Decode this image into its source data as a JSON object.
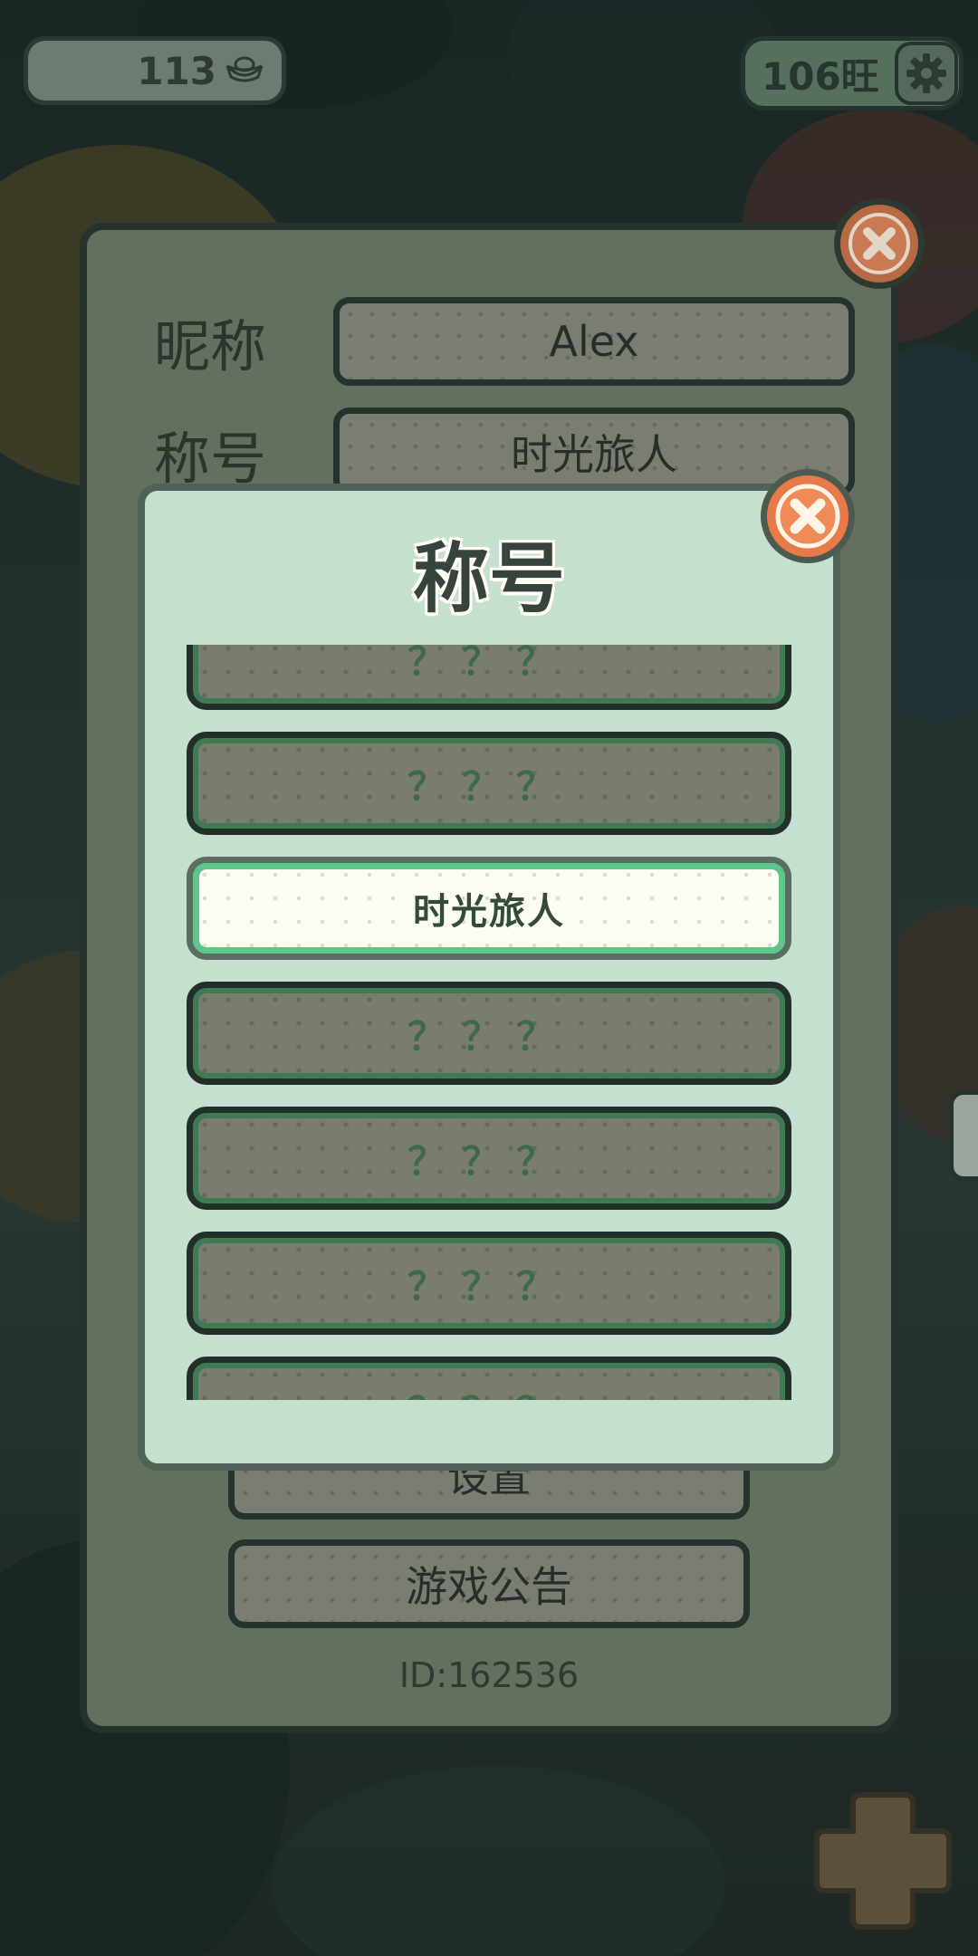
{
  "hud": {
    "currency_value": "113",
    "currency_icon": "ingot-icon",
    "wang_value": "106旺",
    "settings_icon": "gear-icon"
  },
  "profile_panel": {
    "nickname_label": "昵称",
    "nickname_value": "Alex",
    "title_label": "称号",
    "title_value": "时光旅人",
    "settings_button": "设置",
    "announcement_button": "游戏公告",
    "user_id": "ID:162536",
    "close_icon": "close-icon"
  },
  "title_modal": {
    "heading": "称号",
    "close_icon": "close-icon",
    "items": [
      {
        "label": "？？？",
        "selected": false
      },
      {
        "label": "？？？",
        "selected": false
      },
      {
        "label": "时光旅人",
        "selected": true
      },
      {
        "label": "？？？",
        "selected": false
      },
      {
        "label": "？？？",
        "selected": false
      },
      {
        "label": "？？？",
        "selected": false
      },
      {
        "label": "？？？",
        "selected": false
      }
    ]
  },
  "colors": {
    "modal_bg": "#c5e0ce",
    "selected_border": "#5bc78a",
    "close_button": "#e8794a"
  }
}
